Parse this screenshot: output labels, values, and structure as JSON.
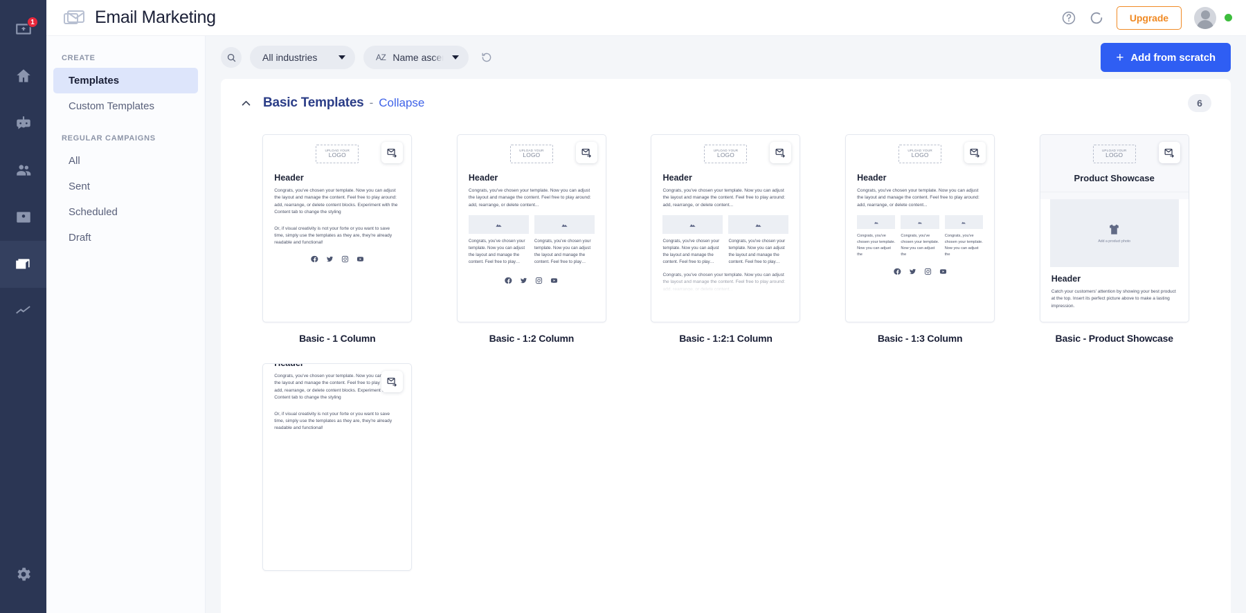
{
  "rail": {
    "items": [
      {
        "name": "inbox-icon",
        "badge": "1"
      },
      {
        "name": "home-icon",
        "badge": null
      },
      {
        "name": "chatbot-icon",
        "badge": null
      },
      {
        "name": "contacts-icon",
        "badge": null
      },
      {
        "name": "address-book-icon",
        "badge": null
      },
      {
        "name": "email-icon",
        "badge": null
      },
      {
        "name": "analytics-icon",
        "badge": null
      }
    ],
    "bottom": {
      "name": "settings-icon"
    }
  },
  "topbar": {
    "title": "Email Marketing",
    "help_label": "Help",
    "refresh_label": "Refresh",
    "upgrade_label": "Upgrade",
    "status": "online"
  },
  "leftnav": {
    "sections": [
      {
        "label": "CREATE",
        "items": [
          {
            "label": "Templates",
            "active": true
          },
          {
            "label": "Custom Templates",
            "active": false
          }
        ]
      },
      {
        "label": "REGULAR CAMPAIGNS",
        "items": [
          {
            "label": "All",
            "active": false
          },
          {
            "label": "Sent",
            "active": false
          },
          {
            "label": "Scheduled",
            "active": false
          },
          {
            "label": "Draft",
            "active": false
          }
        ]
      }
    ]
  },
  "toolbar": {
    "search_label": "Search",
    "industries_value": "All industries",
    "sort_value": "Name ascending",
    "sort_icon_label": "AZ",
    "reset_label": "Reset filters",
    "add_label": "Add from scratch",
    "add_plus": "+"
  },
  "panel": {
    "title": "Basic Templates",
    "dash": "-",
    "collapse_label": "Collapse",
    "count": "6"
  },
  "template_copy": {
    "logo_line1": "UPLOAD YOUR",
    "logo_line2": "LOGO",
    "header": "Header",
    "body1": "Congrats, you've chosen your template. Now you can adjust the layout and manage the content. Feel free to play around: add, rearrange, or delete content blocks. Experiment with the Content tab to change the styling",
    "body2": "Or, if visual creativity is not your forte or you want to save time, simply use the templates as they are, they're already readable and functional!",
    "body_trunc": "Congrats, you've chosen your template. Now you can adjust the layout and manage the content. Feel free to play around: add, rearrange, or delete content...",
    "col_text": "Congrats, you've chosen your template. Now you can adjust the layout and manage the content. Feel free to play…",
    "col_text_narrow": "Congrats, you've chosen your template. Now you can adjust the",
    "ps_title": "Product Showcase",
    "ps_photo_caption": "Add a product photo",
    "ps_body": "Catch your customers' attention by showing your best product at the top. Insert its perfect picture above to make a lasting impression."
  },
  "templates": [
    {
      "name": "Basic - 1 Column",
      "layout": "one"
    },
    {
      "name": "Basic - 1:2 Column",
      "layout": "two"
    },
    {
      "name": "Basic - 1:2:1 Column",
      "layout": "twoone"
    },
    {
      "name": "Basic - 1:3 Column",
      "layout": "three"
    },
    {
      "name": "Basic - Product Showcase",
      "layout": "showcase"
    },
    {
      "name": "",
      "layout": "plain"
    }
  ],
  "colors": {
    "rail_bg": "#2b3654",
    "accent_blue": "#2f5ef3",
    "upgrade_orange": "#f08a24",
    "badge_red": "#e8283c",
    "status_green": "#3dbd3d",
    "panel_title": "#2b3d87"
  }
}
